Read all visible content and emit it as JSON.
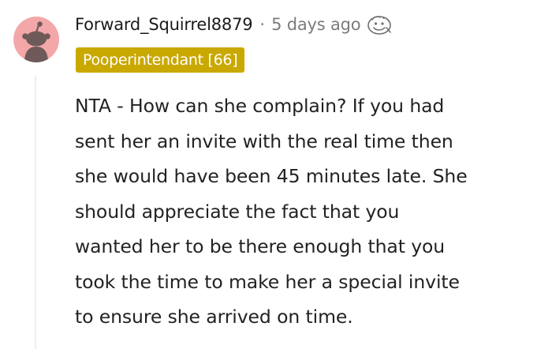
{
  "comment": {
    "username": "Forward_Squirrel8879",
    "separator": "·",
    "timestamp": "5 days ago",
    "award_icon": "award-face-icon",
    "flair": "Pooperintendant [66]",
    "body_lines": [
      "NTA - How can she complain? If you had",
      "sent her an invite with the real time then",
      "she would have been 45 minutes late. She",
      "should appreciate the fact that you",
      "wanted her to be there enough that you",
      "took the time to make her a special invite",
      "to ensure she arrived on time."
    ]
  },
  "colors": {
    "avatar_bg": "#f3a7a9",
    "avatar_figure": "#6e5a58",
    "flair_bg": "#c9a800",
    "flair_text": "#ffffff",
    "meta_text": "#7c7c7c",
    "body_text": "#222222"
  }
}
